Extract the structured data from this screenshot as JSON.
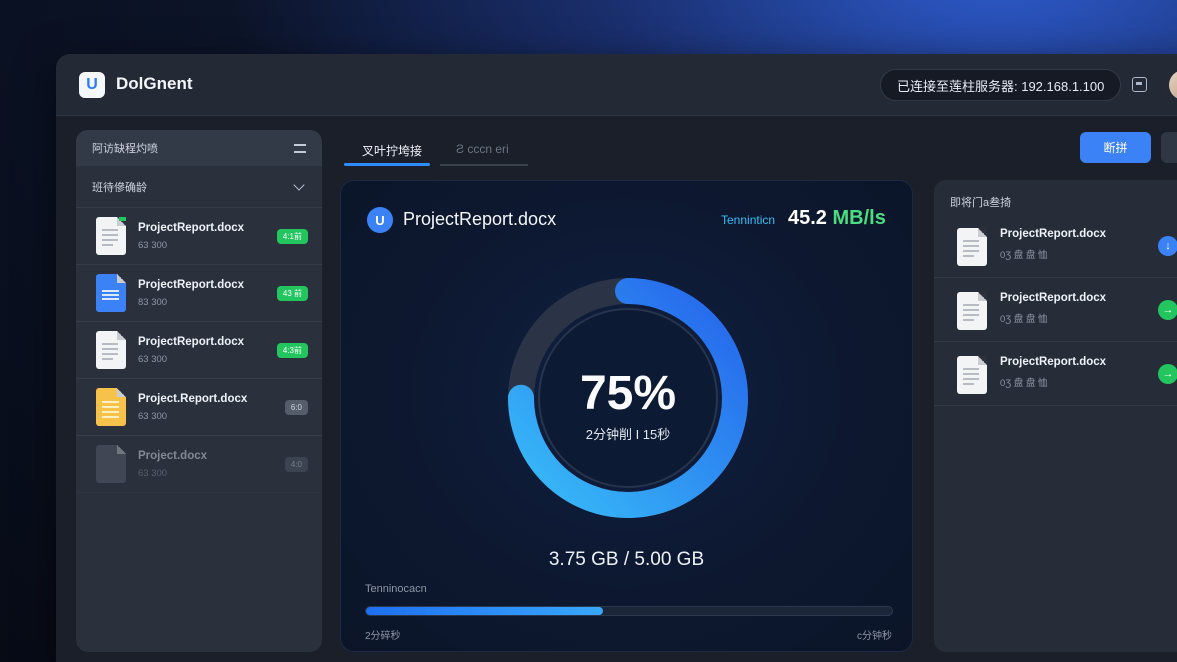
{
  "app": {
    "logo_letter": "U",
    "title": "DolGnent"
  },
  "header": {
    "connection_status": "已连接至莲柱服务器: 192.168.1.100"
  },
  "left_panel": {
    "header_label": "阿访缺程灼喷",
    "section_label": "班待傪确龄",
    "files": [
      {
        "name": "ProjectReport.docx",
        "meta": "63  300",
        "badge": "4:1前",
        "icon": "doc-white-icon",
        "status": "active"
      },
      {
        "name": "ProjectReport.docx",
        "meta": "83  300",
        "badge": "43 前",
        "icon": "doc-blue-icon",
        "status": "active"
      },
      {
        "name": "ProjectReport.docx",
        "meta": "63  300",
        "badge": "4:3前",
        "icon": "doc-white-icon",
        "status": "active"
      },
      {
        "name": "Project.Report.docx",
        "meta": "63  300",
        "badge": "6:0",
        "icon": "doc-yellow-icon",
        "status": "queued"
      },
      {
        "name": "Project.docx",
        "meta": "63  300",
        "badge": "4:0",
        "icon": "doc-gray-icon",
        "status": "disabled"
      }
    ]
  },
  "tabs": [
    {
      "label": "叉叶拧垮接",
      "active": true
    },
    {
      "label": "Ƨ  cccn eri",
      "active": false
    }
  ],
  "actions": {
    "primary_label": "断拼"
  },
  "transfer": {
    "file_name": "ProjectReport.docx",
    "file_icon_letter": "U",
    "speed_label": "Tenninticn",
    "speed_value": "45.2",
    "speed_unit": "MB/ls",
    "percent_value": 75,
    "percent_text": "75%",
    "time_remaining": "2分钟削 I 15秒",
    "size_text": "3.75 GB / 5.00 GB",
    "progress_label": "Tenninocacn",
    "progress_fraction": 0.45,
    "elapsed_label": "2分碎秒",
    "eta_label": "c分钟秒",
    "colors": {
      "ring_start": "#38bdf8",
      "ring_end": "#2563eb",
      "accent": "#3b82f6",
      "success": "#4ade80"
    }
  },
  "right_panel": {
    "title": "即将门a叁掎",
    "files": [
      {
        "name": "ProjectReport.docx",
        "meta": "0Ʒ  盘 盘 恤",
        "action_icon": "download-icon",
        "action_color": "blue",
        "action_glyph": "↓"
      },
      {
        "name": "ProjectReport.docx",
        "meta": "0Ʒ  盘 盘 恤",
        "action_icon": "arrow-right-icon",
        "action_color": "green",
        "action_glyph": "→"
      },
      {
        "name": "ProjectReport.docx",
        "meta": "0Ʒ  盘 盘 恤",
        "action_icon": "arrow-right-icon",
        "action_color": "green",
        "action_glyph": "→"
      }
    ]
  }
}
